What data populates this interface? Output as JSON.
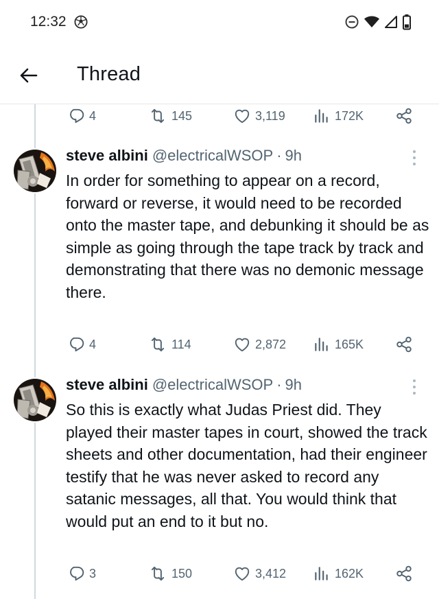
{
  "status_bar": {
    "time": "12:32",
    "app_icon": "soccer-ball-icon",
    "icons": [
      "do-not-disturb-icon",
      "wifi-icon",
      "signal-icon",
      "battery-icon"
    ]
  },
  "header": {
    "back_icon": "arrow-left-icon",
    "title": "Thread"
  },
  "top_actions": {
    "replies": "4",
    "reposts": "145",
    "likes": "3,119",
    "views": "172K"
  },
  "tweets": [
    {
      "author_name": "steve albini",
      "handle": "@electricalWSOP",
      "separator": "·",
      "time": "9h",
      "text": "In order for something to appear on a record, forward or reverse, it would need to be recorded onto the master tape, and debunking it should be as simple as going through the tape track by track and demonstrating that there was no demonic message there.",
      "actions": {
        "replies": "4",
        "reposts": "114",
        "likes": "2,872",
        "views": "165K"
      }
    },
    {
      "author_name": "steve albini",
      "handle": "@electricalWSOP",
      "separator": "·",
      "time": "9h",
      "text": "So this is exactly what Judas Priest did. They played their master tapes in court, showed the track sheets and other documentation, had their engineer testify that he was never asked to record any satanic messages, all that. You would think that would put an end to it but no.",
      "actions": {
        "replies": "3",
        "reposts": "150",
        "likes": "3,412",
        "views": "162K"
      }
    }
  ],
  "colors": {
    "text_primary": "#0f1419",
    "text_secondary": "#536471",
    "thread_line": "#cfd9de",
    "divider": "#e6e6e6"
  }
}
